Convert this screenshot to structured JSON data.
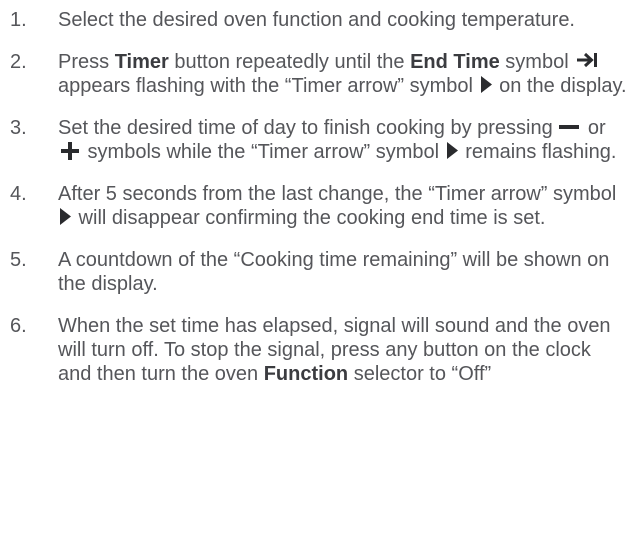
{
  "steps": [
    {
      "num": "1.",
      "p1": "Select the desired oven function and cooking temperature."
    },
    {
      "num": "2.",
      "p1": "Press ",
      "b1": "Timer",
      "p2": " button repeatedly until the ",
      "b2": "End Time",
      "p3": " symbol ",
      "p4": " appears flashing with the “Timer arrow” symbol ",
      "p5": " on the display."
    },
    {
      "num": "3.",
      "p1": "Set the desired time of day to finish cooking by pressing ",
      "p2": " or ",
      "p3": " symbols while the “Timer arrow” symbol ",
      "p4": " remains flashing."
    },
    {
      "num": "4.",
      "p1": "After 5 seconds from the last change, the “Timer arrow” symbol ",
      "p2": " will disappear confirming the cooking end time is set."
    },
    {
      "num": "5.",
      "p1": "A countdown of the “Cooking time remaining” will be shown on the display."
    },
    {
      "num": "6.",
      "p1": "When the set time has elapsed, signal will sound and the oven will turn off. To stop the signal, press any button on the clock and then turn the oven ",
      "b1": "Function",
      "p2": " selector to “Off”"
    }
  ],
  "icons": {
    "end_time": "end-time-arrow-icon",
    "timer_arrow": "timer-arrow-triangle-icon",
    "minus": "minus-icon",
    "plus": "plus-icon"
  },
  "colors": {
    "text": "#55565a",
    "bold_text": "#3b3c40",
    "icon": "#2a2b2e"
  }
}
